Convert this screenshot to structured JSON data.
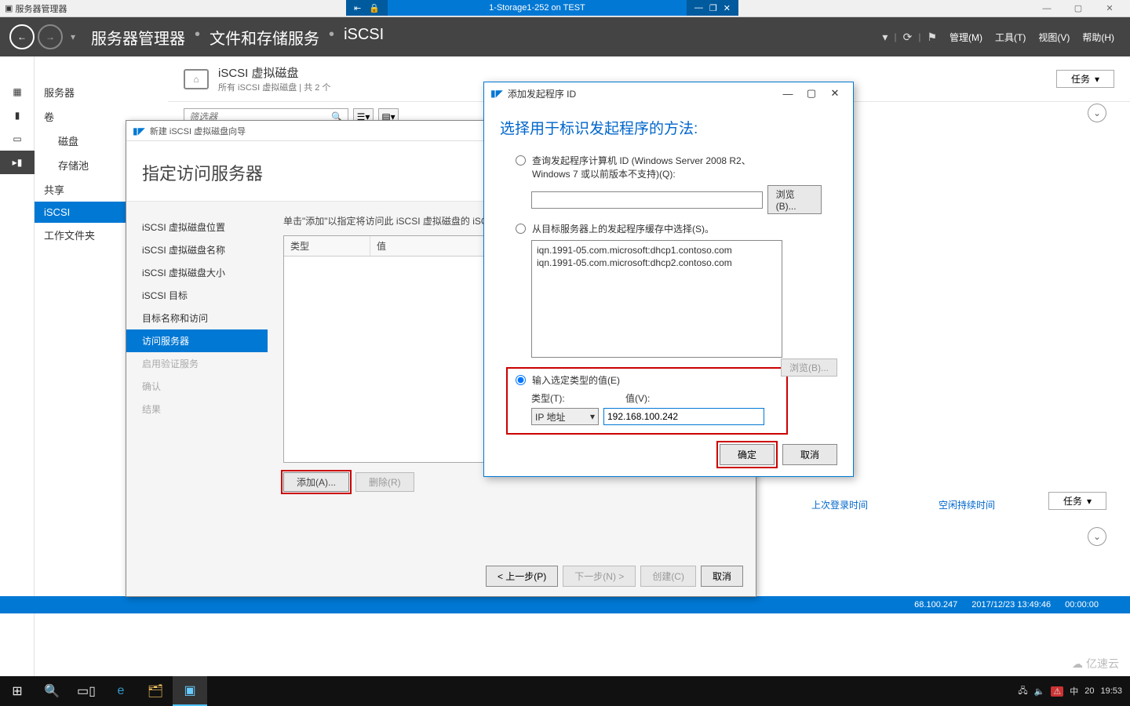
{
  "outer_window_title": "服务器管理器",
  "vm_bar": {
    "title": "1-Storage1-252 on TEST"
  },
  "header": {
    "breadcrumb": [
      "服务器管理器",
      "文件和存储服务",
      "iSCSI"
    ],
    "menus": [
      "管理(M)",
      "工具(T)",
      "视图(V)",
      "帮助(H)"
    ]
  },
  "side_nav": {
    "items": [
      {
        "label": "服务器",
        "indent": false
      },
      {
        "label": "卷",
        "indent": false
      },
      {
        "label": "磁盘",
        "indent": true
      },
      {
        "label": "存储池",
        "indent": true
      },
      {
        "label": "共享",
        "indent": false
      },
      {
        "label": "iSCSI",
        "indent": false,
        "selected": true
      },
      {
        "label": "工作文件夹",
        "indent": false
      }
    ]
  },
  "panel": {
    "title": "iSCSI 虚拟磁盘",
    "subtitle": "所有 iSCSI 虚拟磁盘 | 共 2 个",
    "tasks_btn": "任务",
    "search_placeholder": "筛选器"
  },
  "lower_panel": {
    "tasks_btn": "任务",
    "col1": "上次登录时间",
    "col2": "空闲持续时间",
    "row_ip": "68.100.247",
    "row_time": "2017/12/23 13:49:46",
    "row_idle": "00:00:00"
  },
  "wizard": {
    "window_title": "新建 iSCSI 虚拟磁盘向导",
    "heading": "指定访问服务器",
    "steps": [
      {
        "label": "iSCSI 虚拟磁盘位置",
        "state": "done"
      },
      {
        "label": "iSCSI 虚拟磁盘名称",
        "state": "done"
      },
      {
        "label": "iSCSI 虚拟磁盘大小",
        "state": "done"
      },
      {
        "label": "iSCSI 目标",
        "state": "done"
      },
      {
        "label": "目标名称和访问",
        "state": "done"
      },
      {
        "label": "访问服务器",
        "state": "current"
      },
      {
        "label": "启用验证服务",
        "state": "future"
      },
      {
        "label": "确认",
        "state": "future"
      },
      {
        "label": "结果",
        "state": "future"
      }
    ],
    "instruction": "单击\"添加\"以指定将访问此 iSCSI 虚拟磁盘的 iSC",
    "grid_headers": [
      "类型",
      "值"
    ],
    "add_btn": "添加(A)...",
    "remove_btn": "删除(R)",
    "footer": {
      "prev": "< 上一步(P)",
      "next": "下一步(N) >",
      "create": "创建(C)",
      "cancel": "取消"
    }
  },
  "dialog": {
    "window_title": "添加发起程序 ID",
    "heading": "选择用于标识发起程序的方法:",
    "opt1": "查询发起程序计算机 ID (Windows Server 2008 R2、Windows 7 或以前版本不支持)(Q):",
    "browse1": "浏览(B)...",
    "opt2": "从目标服务器上的发起程序缓存中选择(S)。",
    "cache_items": [
      "iqn.1991-05.com.microsoft:dhcp1.contoso.com",
      "iqn.1991-05.com.microsoft:dhcp2.contoso.com"
    ],
    "opt3": "输入选定类型的值(E)",
    "type_label": "类型(T):",
    "value_label": "值(V):",
    "type_selected": "IP 地址",
    "value_input": "192.168.100.242",
    "browse2": "浏览(B)...",
    "ok": "确定",
    "cancel": "取消"
  },
  "taskbar": {
    "clock": "19:53",
    "ime": "中",
    "tray_text": "20"
  },
  "watermark": "亿速云"
}
